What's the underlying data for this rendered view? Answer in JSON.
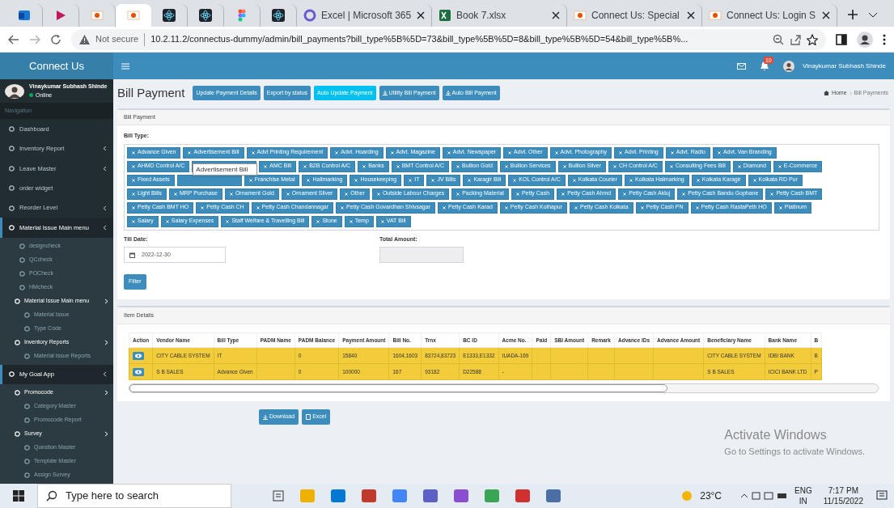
{
  "browser": {
    "tabs": [
      {
        "kind": "icon",
        "selected": false
      },
      {
        "kind": "icon",
        "selected": false
      },
      {
        "kind": "icon",
        "selected": false
      },
      {
        "kind": "icon",
        "selected": true
      },
      {
        "kind": "icon",
        "selected": false
      },
      {
        "kind": "icon",
        "selected": false
      },
      {
        "kind": "icon",
        "selected": false
      },
      {
        "kind": "icon",
        "selected": false
      },
      {
        "kind": "titled",
        "label": "Excel | Microsoft 365",
        "selected": false
      },
      {
        "kind": "titled",
        "label": "Book 7.xlsx",
        "selected": false
      },
      {
        "kind": "titled",
        "label": "Connect Us: Special",
        "selected": false
      },
      {
        "kind": "titled",
        "label": "Connect Us: Login S",
        "selected": false
      }
    ],
    "address": {
      "warning": "Not secure",
      "url": "10.2.11.2/connectus-dummy/admin/bill_payments?bill_type%5B%5D=73&bill_type%5B%5D=8&bill_type%5B%5D=54&bill_type%5B%..."
    }
  },
  "app": {
    "brand": "Connect Us",
    "header_user": "Vinaykumar Subhash Shinde",
    "notification_count": "10"
  },
  "sidebar": {
    "user": {
      "name": "Vinaykumar Subhash Shinde",
      "status": "Online"
    },
    "section": "Navigation",
    "items": [
      {
        "label": "Dashboard",
        "has_caret": false,
        "expanded": false
      },
      {
        "label": "Inventory Report",
        "has_caret": true,
        "expanded": false
      },
      {
        "label": "Leave Master",
        "has_caret": true,
        "expanded": false
      },
      {
        "label": "order widget",
        "has_caret": false,
        "expanded": false
      },
      {
        "label": "Reorder Level",
        "has_caret": true,
        "expanded": false
      },
      {
        "label": "Material Issue Main menu",
        "has_caret": true,
        "expanded": true,
        "children": [
          {
            "label": "designcheck"
          },
          {
            "label": "QCcheck"
          },
          {
            "label": "POCheck"
          },
          {
            "label": "HMcheck"
          },
          {
            "label": "Material Issue Main menu",
            "children": [
              {
                "label": "Material Issue"
              },
              {
                "label": "Type Code"
              }
            ]
          },
          {
            "label": "Inventory Reports",
            "children": [
              {
                "label": "Material Issue Reports"
              }
            ]
          }
        ]
      },
      {
        "label": "My Goal App",
        "has_caret": true,
        "expanded": true,
        "children": [
          {
            "label": "Promocode",
            "children": [
              {
                "label": "Category Master"
              },
              {
                "label": "Promocode Report"
              }
            ]
          },
          {
            "label": "Survey",
            "children": [
              {
                "label": "Question Master"
              },
              {
                "label": "Template Master"
              },
              {
                "label": "Assign Survey"
              }
            ]
          }
        ]
      }
    ]
  },
  "page": {
    "title": "Bill Payment",
    "buttons": [
      {
        "label": "Update Payment Details",
        "highlighted": false,
        "icon": false
      },
      {
        "label": "Export by status",
        "highlighted": false,
        "icon": false
      },
      {
        "label": "Auto Update Payment",
        "highlighted": true,
        "icon": false
      },
      {
        "label": "Utility Bill Payment",
        "highlighted": false,
        "icon": true
      },
      {
        "label": "Auto Bill Payment",
        "highlighted": false,
        "icon": true
      }
    ],
    "breadcrumb": [
      "Home",
      "Bill Payments"
    ],
    "panel_title": "Bill Payment",
    "bill_type_label": "Bill Type:",
    "tag_rows": [
      [
        {
          "kind": "tag",
          "label": "Advance Given"
        },
        {
          "kind": "tag",
          "label": "Advertisement Bill"
        },
        {
          "kind": "tag",
          "label": "Advt Printing Requirement"
        },
        {
          "kind": "tag",
          "label": "Advt. Hoarding"
        },
        {
          "kind": "tag",
          "label": "Advt. Magazine"
        },
        {
          "kind": "tag",
          "label": "Advt. Newspaper"
        },
        {
          "kind": "tag",
          "label": "Advt. Other"
        },
        {
          "kind": "tag",
          "label": "Advt. Photography"
        },
        {
          "kind": "tag",
          "label": "Advt. Printing"
        },
        {
          "kind": "tag",
          "label": "Advt. Radio"
        },
        {
          "kind": "tag",
          "label": "Advt. Van Branding"
        }
      ],
      [
        {
          "kind": "tag",
          "label": "AHMD Control A/C"
        },
        {
          "kind": "covered"
        },
        {
          "kind": "tag",
          "label": "AMC Bill"
        },
        {
          "kind": "tag",
          "label": "B2B Control A/C"
        },
        {
          "kind": "tag",
          "label": "Banks"
        },
        {
          "kind": "tag",
          "label": "BMT Control A/C"
        },
        {
          "kind": "tag",
          "label": "Bullion Gold"
        },
        {
          "kind": "tag",
          "label": "Bullion Services"
        },
        {
          "kind": "tag",
          "label": "Bullion Silver"
        },
        {
          "kind": "tag",
          "label": "CH Control A/C"
        },
        {
          "kind": "tag",
          "label": "Consulting Fees Bill"
        },
        {
          "kind": "tag",
          "label": "Diamond"
        },
        {
          "kind": "tag",
          "label": "E-Commerce"
        }
      ],
      [
        {
          "kind": "tag",
          "label": "Fixed Assets"
        },
        {
          "kind": "covered"
        },
        {
          "kind": "tag",
          "label": "Franchise Metal"
        },
        {
          "kind": "tag",
          "label": "Hallmarking"
        },
        {
          "kind": "tag",
          "label": "Housekeeping"
        },
        {
          "kind": "tag",
          "label": "IT"
        },
        {
          "kind": "tag",
          "label": "JV Bills"
        },
        {
          "kind": "tag",
          "label": "Karagir Bill"
        },
        {
          "kind": "tag",
          "label": "KOL Control A/C"
        },
        {
          "kind": "tag",
          "label": "Kolkata Courier"
        },
        {
          "kind": "tag",
          "label": "Kolkata Halmarking"
        },
        {
          "kind": "tag",
          "label": "Kolkata Karagir"
        },
        {
          "kind": "tag",
          "label": "Kolkata RD Pur"
        }
      ],
      [
        {
          "kind": "tag",
          "label": "Light Bills"
        },
        {
          "kind": "tag",
          "label": "MRP Purchase"
        },
        {
          "kind": "tag",
          "label": "Ornament Gold"
        },
        {
          "kind": "tag",
          "label": "Ornament Silver"
        },
        {
          "kind": "tag",
          "label": "Other"
        },
        {
          "kind": "tag",
          "label": "Outside Labour Charges"
        },
        {
          "kind": "tag",
          "label": "Packing Material"
        },
        {
          "kind": "tag",
          "label": "Petty Cash"
        },
        {
          "kind": "tag",
          "label": "Petty Cash Ahmd"
        },
        {
          "kind": "tag",
          "label": "Petty Cash Akluj"
        },
        {
          "kind": "tag",
          "label": "Petty Cash Bandu Gophane"
        },
        {
          "kind": "tag",
          "label": "Petty Cash BMT"
        }
      ],
      [
        {
          "kind": "tag",
          "label": "Petty Cash BMT HO"
        },
        {
          "kind": "tag",
          "label": "Petty Cash CH"
        },
        {
          "kind": "tag",
          "label": "Petty Cash Chandannagar"
        },
        {
          "kind": "tag",
          "label": "Petty Cash Govardhan Shivsagar"
        },
        {
          "kind": "tag",
          "label": "Petty Cash Karad"
        },
        {
          "kind": "tag",
          "label": "Petty Cash Kolhapur"
        },
        {
          "kind": "tag",
          "label": "Petty Cash Kolkata"
        },
        {
          "kind": "tag",
          "label": "Petty Cash PN"
        },
        {
          "kind": "tag",
          "label": "Petty Cash RastaPeth HO"
        },
        {
          "kind": "tag",
          "label": "Platinum"
        }
      ],
      [
        {
          "kind": "tag",
          "label": "Salary"
        },
        {
          "kind": "tag",
          "label": "Salary Expenses"
        },
        {
          "kind": "tag",
          "label": "Staff Welfare & Travelling Bill"
        },
        {
          "kind": "tag",
          "label": "Stone"
        },
        {
          "kind": "tag",
          "label": "Temp"
        },
        {
          "kind": "tag",
          "label": "VAT Bill"
        }
      ]
    ],
    "tooltip": "Advertisement Bill",
    "till_date_label": "Till Date:",
    "till_date": "2022-12-30",
    "total_amount_label": "Total Amount:",
    "filter": "Filter",
    "item_details_title": "Item Details",
    "table": {
      "columns": [
        "Action",
        "Vendor Name",
        "Bill Type",
        "PADM Name",
        "PADM Balance",
        "Payment Amount",
        "Bill No.",
        "Trnx",
        "BC ID",
        "Acme No.",
        "Paid",
        "SBI Amount",
        "Remark",
        "Advance IDs",
        "Advance Amount",
        "Beneficiary Name",
        "Bank Name",
        "B"
      ],
      "rows": [
        [
          "",
          "CITY CABLE SYSTEM",
          "IT",
          "",
          "0",
          "15840",
          "1604,1603",
          "83724,83723",
          "E1333,E1332",
          "IUADA-169",
          "",
          "",
          "",
          "",
          "",
          "CITY CABLE SYSTEM",
          "IDBI BANK",
          "B"
        ],
        [
          "",
          "S B SALES",
          "Advance Given",
          "",
          "0",
          "100000",
          "167",
          "93182",
          "D22588",
          "-",
          "",
          "",
          "",
          "",
          "",
          "S B SALES",
          "ICICI BANK LTD",
          "P"
        ]
      ]
    },
    "download": "Download",
    "excel": "Excel"
  },
  "activation": {
    "title": "Activate Windows",
    "hint": "Go to Settings to activate Windows."
  },
  "taskbar": {
    "search": "Type here to search",
    "temperature": "23°C",
    "lang": "ENG",
    "region": "IN",
    "time": "7:17 PM",
    "date": "11/15/2022"
  }
}
